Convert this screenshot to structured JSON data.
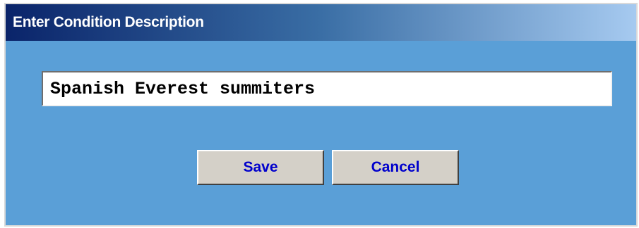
{
  "dialog": {
    "title": "Enter Condition Description",
    "description_value": "Spanish Everest summiters",
    "save_label": "Save",
    "cancel_label": "Cancel"
  },
  "colors": {
    "dialog_background": "#5a9fd7",
    "title_gradient_start": "#0a246a",
    "title_gradient_end": "#a6caf0",
    "button_face": "#d4d0c8",
    "button_text": "#0000cc"
  }
}
